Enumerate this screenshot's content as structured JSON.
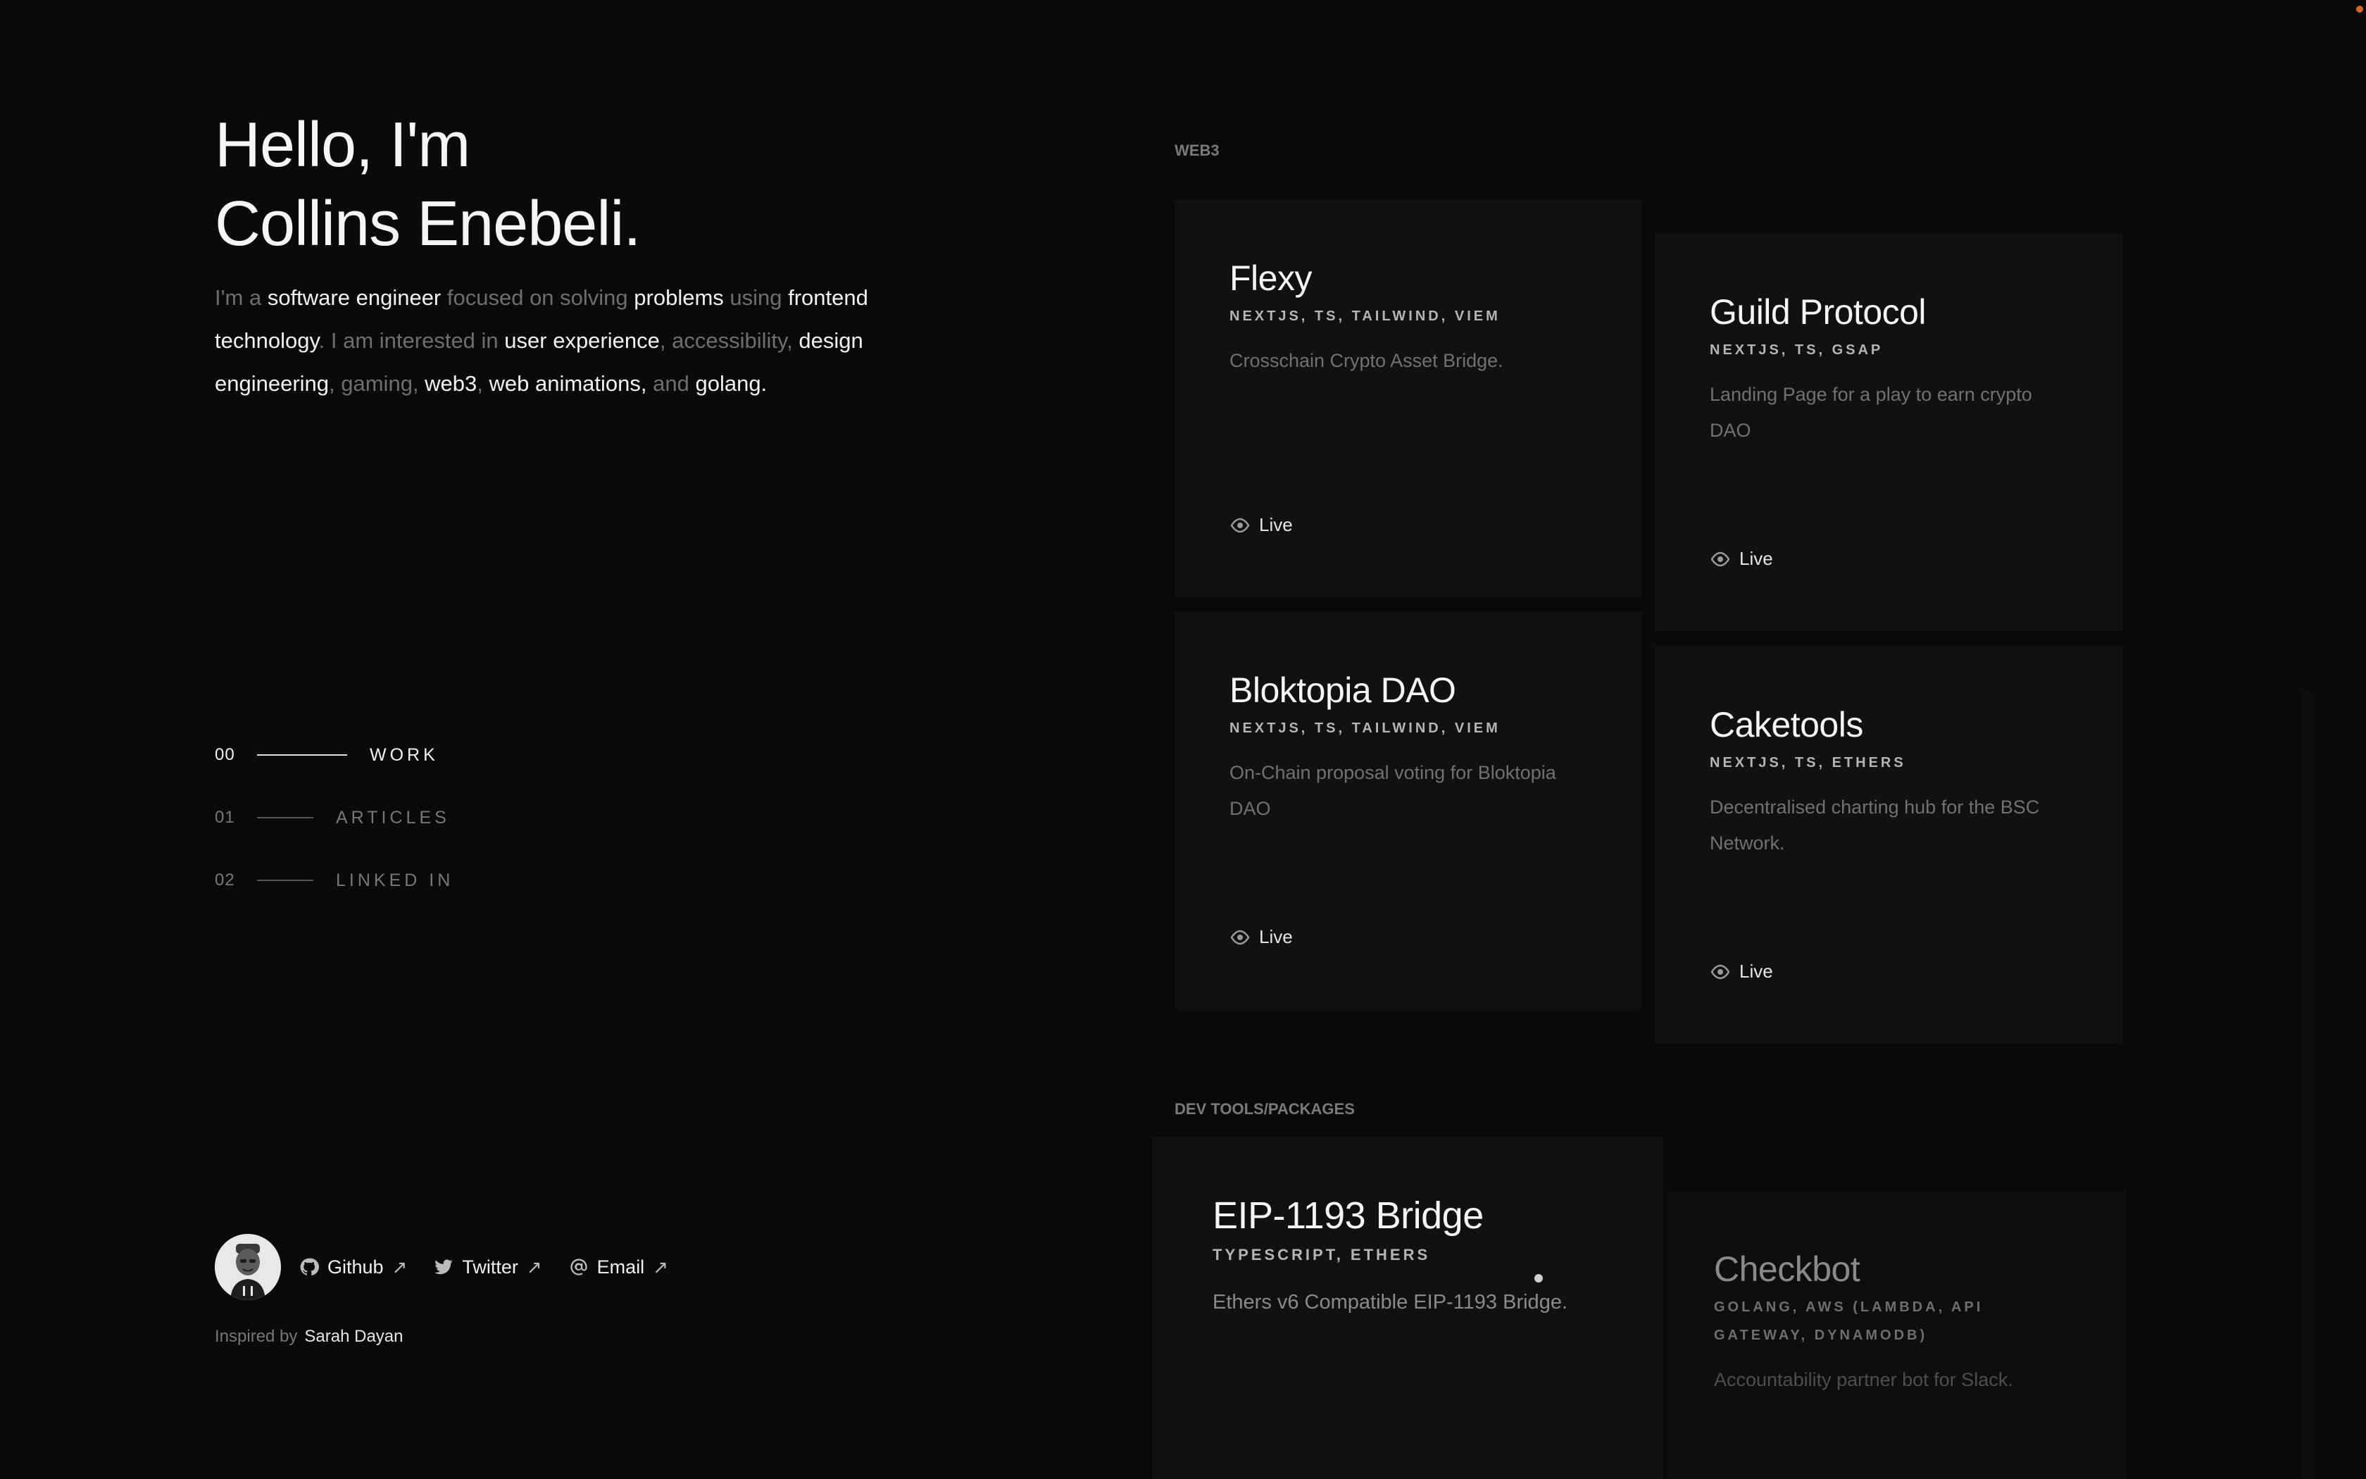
{
  "hero": {
    "title_line1": "Hello, I'm",
    "title_line2": "Collins Enebeli.",
    "intro": [
      {
        "t": "I'm a ",
        "hl": false
      },
      {
        "t": "software engineer",
        "hl": true
      },
      {
        "t": " focused on solving ",
        "hl": false
      },
      {
        "t": "problems",
        "hl": true
      },
      {
        "t": " using ",
        "hl": false
      },
      {
        "t": "frontend technology",
        "hl": true
      },
      {
        "t": ". I am interested in ",
        "hl": false
      },
      {
        "t": "user experience",
        "hl": true
      },
      {
        "t": ", accessibility, ",
        "hl": false
      },
      {
        "t": "design engineering",
        "hl": true
      },
      {
        "t": ", gaming, ",
        "hl": false
      },
      {
        "t": "web3",
        "hl": true
      },
      {
        "t": ", ",
        "hl": false
      },
      {
        "t": "web animations,",
        "hl": true
      },
      {
        "t": " and ",
        "hl": false
      },
      {
        "t": "golang.",
        "hl": true
      }
    ]
  },
  "nav": {
    "items": [
      {
        "num": "00",
        "label": "WORK",
        "active": true
      },
      {
        "num": "01",
        "label": "ARTICLES",
        "active": false
      },
      {
        "num": "02",
        "label": "LINKED IN",
        "active": false
      }
    ]
  },
  "footer": {
    "links": [
      {
        "label": "Github",
        "icon": "github-icon",
        "arrow": "↗"
      },
      {
        "label": "Twitter",
        "icon": "twitter-icon",
        "arrow": "↗"
      },
      {
        "label": "Email",
        "icon": "at-icon",
        "arrow": "↗"
      }
    ],
    "credit_prefix": "Inspired by",
    "credit_name": "Sarah Dayan"
  },
  "sections": {
    "web3_label": "WEB3",
    "devtools_label": "DEV TOOLS/PACKAGES"
  },
  "projects": {
    "flexy": {
      "title": "Flexy",
      "tags": "NEXTJS, TS, TAILWIND, VIEM",
      "desc": "Crosschain Crypto Asset Bridge.",
      "live": "Live"
    },
    "guild": {
      "title": "Guild Protocol",
      "tags": "NEXTJS, TS, GSAP",
      "desc": "Landing Page for a play to earn crypto DAO",
      "live": "Live"
    },
    "bloktopia": {
      "title": "Bloktopia DAO",
      "tags": "NEXTJS, TS, TAILWIND, VIEM",
      "desc": "On-Chain proposal voting for Bloktopia DAO",
      "live": "Live"
    },
    "caketools": {
      "title": "Caketools",
      "tags": "NEXTJS, TS, ETHERS",
      "desc": "Decentralised charting hub for the BSC Network.",
      "live": "Live"
    },
    "eip": {
      "title": "EIP-1193 Bridge",
      "tags": "TYPESCRIPT, ETHERS",
      "desc": "Ethers v6 Compatible EIP-1193 Bridge."
    },
    "checkbot": {
      "title": "Checkbot",
      "tags": "GOLANG, AWS (LAMBDA, API GATEWAY, DYNAMODB)",
      "desc": "Accountability partner bot for Slack."
    }
  },
  "colors": {
    "background": "#0a0a0a",
    "card": "#111111",
    "accent_dot": "#d4662a"
  }
}
